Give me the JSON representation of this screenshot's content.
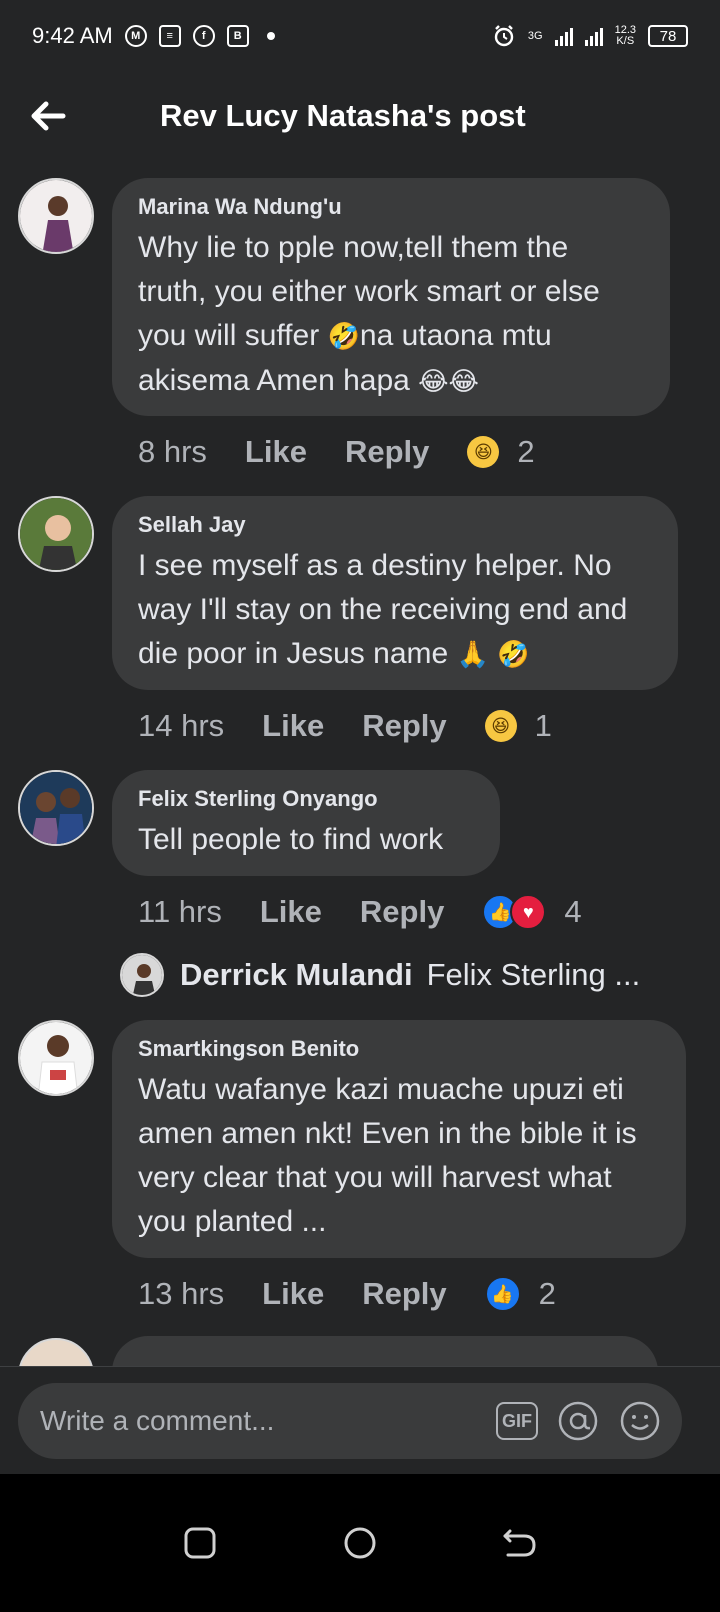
{
  "status_bar": {
    "time": "9:42 AM",
    "network": "3G",
    "speed_value": "12.3",
    "speed_unit": "K/S",
    "battery": "78"
  },
  "header": {
    "title": "Rev Lucy Natasha's post"
  },
  "comments": [
    {
      "author": "Marina Wa Ndung'u",
      "text_parts": [
        "Why lie to pple now,tell them the truth, you either work smart or else you will suffer ",
        "🤣",
        "na utaona mtu akisema Amen hapa ",
        "😂😂"
      ],
      "time": "8 hrs",
      "like_label": "Like",
      "reply_label": "Reply",
      "reaction_icons": [
        "haha-icon"
      ],
      "reaction_count": "2"
    },
    {
      "author": "Sellah Jay",
      "text_parts": [
        "I see myself as a destiny helper. No way I'll stay on the receiving end and die poor in Jesus name ",
        "🙏 🤣"
      ],
      "time": "14 hrs",
      "like_label": "Like",
      "reply_label": "Reply",
      "reaction_icons": [
        "haha-icon"
      ],
      "reaction_count": "1"
    },
    {
      "author": "Felix Sterling Onyango",
      "text": "Tell people to find work",
      "time": "11 hrs",
      "like_label": "Like",
      "reply_label": "Reply",
      "reaction_icons": [
        "like-icon",
        "love-icon"
      ],
      "reaction_count": "4",
      "reply_preview": {
        "author": "Derrick Mulandi",
        "text": "Felix Sterling ..."
      }
    },
    {
      "author": "Smartkingson Benito",
      "text": "Watu wafanye kazi muache upuzi eti amen amen nkt! Even in the bible it is very clear that you will harvest what you planted ...",
      "time": "13 hrs",
      "like_label": "Like",
      "reply_label": "Reply",
      "reaction_icons": [
        "like-icon"
      ],
      "reaction_count": "2"
    }
  ],
  "composer": {
    "placeholder": "Write a comment...",
    "gif_label": "GIF",
    "mention_icon": "at-icon",
    "emoji_icon": "smiley-icon"
  },
  "colors": {
    "background": "#242526",
    "bubble": "#3a3b3c",
    "secondary_text": "#b0b3b8",
    "like_blue": "#1877f2",
    "love_red": "#e41e3f",
    "haha_yellow": "#f7c742"
  }
}
